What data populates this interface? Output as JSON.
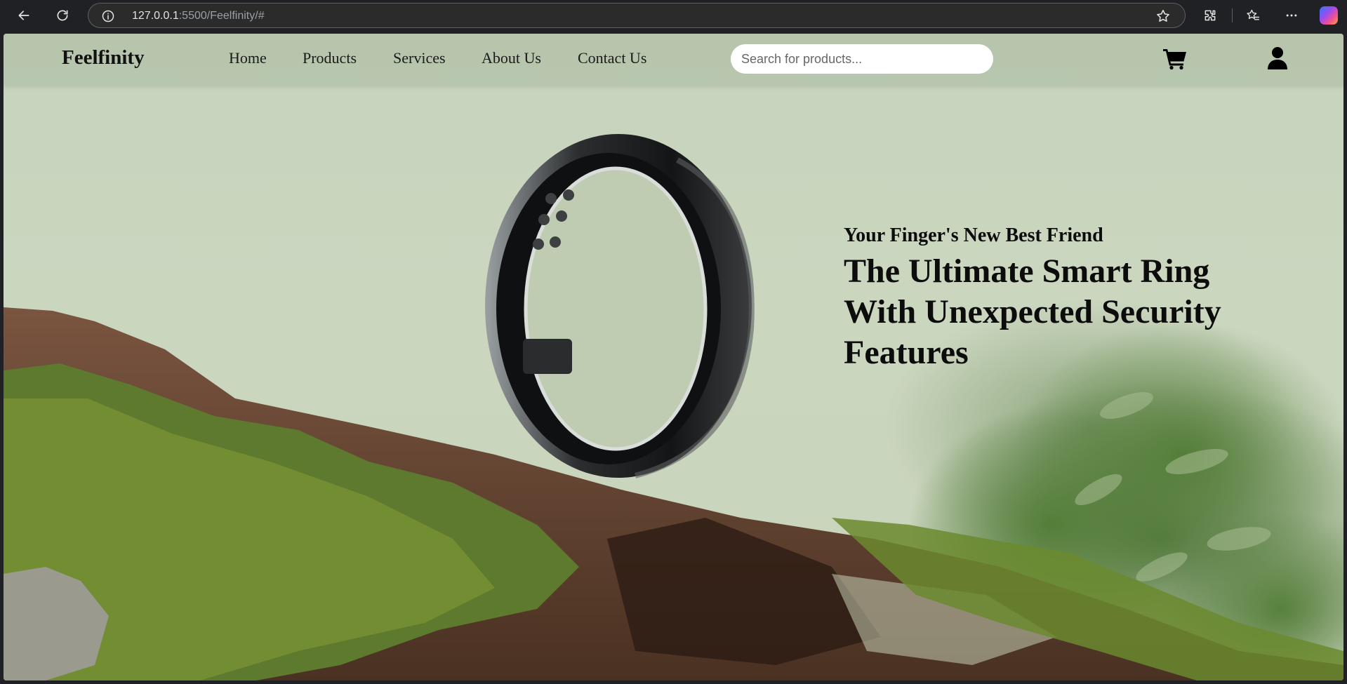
{
  "browser": {
    "url_host": "127.0.0.1",
    "url_rest": ":5500/Feelfinity/#",
    "icons": [
      "back-icon",
      "reload-icon",
      "info-icon",
      "star-icon",
      "extensions-icon",
      "favorites-icon",
      "more-icon",
      "copilot-icon"
    ]
  },
  "navbar": {
    "brand": "Feelfinity",
    "links": [
      "Home",
      "Products",
      "Services",
      "About Us",
      "Contact Us"
    ],
    "search_placeholder": "Search for products...",
    "icons": [
      "cart-icon",
      "user-icon"
    ]
  },
  "hero": {
    "tagline": "Your Finger's New Best Friend",
    "headline_lines": [
      "The Ultimate Smart Ring",
      "With Unexpected Security",
      "Features"
    ]
  },
  "colors": {
    "sky": "#c9d4bb",
    "moss": "#5d7a2e",
    "bark": "#6b4a34",
    "text": "#0c0c0c"
  }
}
